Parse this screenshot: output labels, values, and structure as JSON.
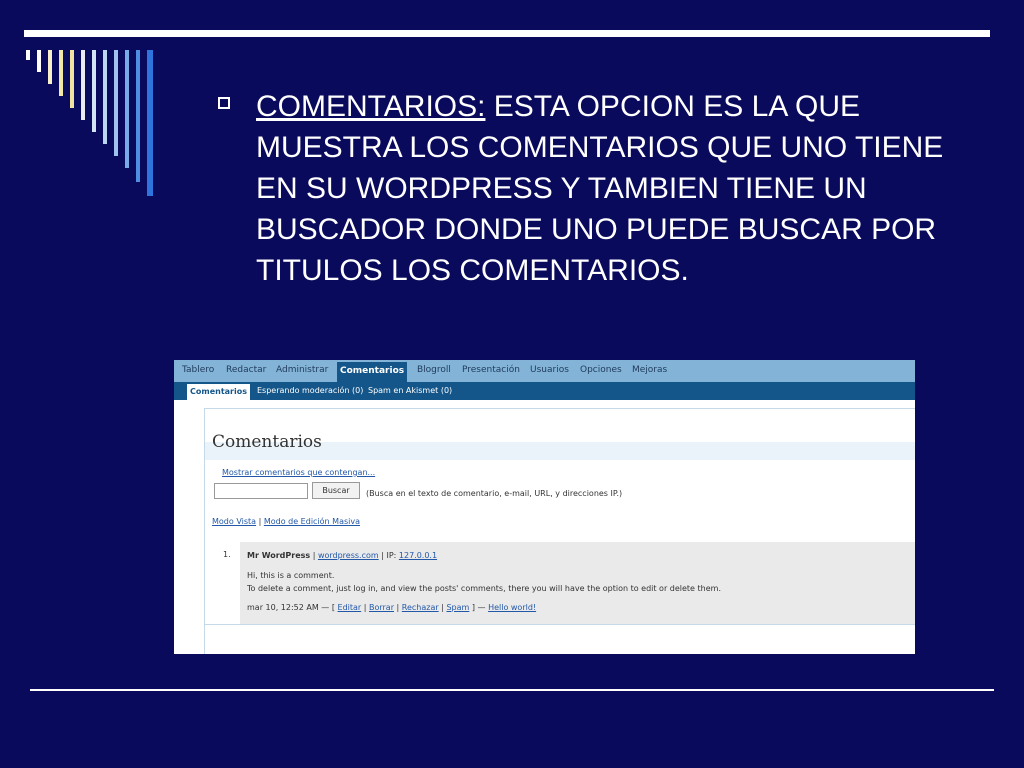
{
  "slide": {
    "heading_label": "COMENTARIOS:",
    "body_text": " ESTA OPCION ES LA QUE MUESTRA LOS COMENTARIOS QUE UNO TIENE EN SU WORDPRESS Y TAMBIEN TIENE UN BUSCADOR DONDE UNO PUEDE BUSCAR POR TITULOS LOS COMENTARIOS.",
    "bar_colors": [
      "#ffffff",
      "#ffffff",
      "#f7f0c8",
      "#f3e7a8",
      "#f0e1a0",
      "#e9ebf0",
      "#d3e4f5",
      "#bcd6f2",
      "#9ec3ee",
      "#79aaea",
      "#4f8ee3",
      "#2f73dc"
    ]
  },
  "screenshot": {
    "nav": [
      "Tablero",
      "Redactar",
      "Administrar",
      "Comentarios",
      "Blogroll",
      "Presentación",
      "Usuarios",
      "Opciones",
      "Mejoras"
    ],
    "nav_active": "Comentarios",
    "subnav": [
      "Comentarios",
      "Esperando moderación (0)",
      "Spam en Akismet (0)"
    ],
    "title": "Comentarios",
    "search_link": "Mostrar comentarios que contengan...",
    "search_input_value": "",
    "search_button": "Buscar",
    "search_hint": "(Busca en el texto de comentario, e-mail, URL, y direcciones IP.)",
    "mode_vista": "Modo Vista",
    "mode_sep": " | ",
    "mode_masiva": "Modo de Edición Masiva",
    "comment": {
      "number": "1.",
      "author": "Mr WordPress",
      "sep1": " | ",
      "url": "wordpress.com",
      "ip_label": " | IP: ",
      "ip": "127.0.0.1",
      "line1": "Hi, this is a comment.",
      "line2": "To delete a comment, just log in, and view the posts' comments, there you will have the option to edit or delete them.",
      "date": "mar 10, 12:52 AM — [ ",
      "edit": "Editar",
      "delete": "Borrar",
      "reject": "Rechazar",
      "spam": "Spam",
      "close": " ] — ",
      "post": "Hello world!",
      "pipe": " | "
    }
  }
}
